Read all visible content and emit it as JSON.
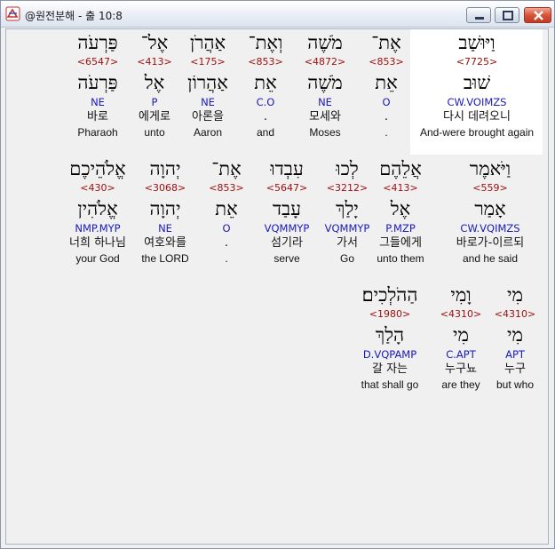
{
  "window": {
    "title": "@원전분해 - 출 10:8",
    "buttons": {
      "minimize": "minimize",
      "maximize": "maximize",
      "close": "close"
    }
  },
  "verse": {
    "rows": [
      {
        "words": [
          {
            "heb": "וַיּוּשַׁב",
            "strong": "<7725>",
            "lex": "שׁוּב",
            "parse": "CW.VOIMZS",
            "kor": "다시 데려오니",
            "eng": "And-were brought again"
          },
          {
            "heb": "אֶת־",
            "strong": "<853>",
            "lex": "אֵת",
            "parse": "O",
            "kor": ".",
            "eng": "."
          },
          {
            "heb": "מֹשֶׁה",
            "strong": "<4872>",
            "lex": "מֹשֶׁה",
            "parse": "NE",
            "kor": "모세와",
            "eng": "Moses"
          },
          {
            "heb": "וְאֶת־",
            "strong": "<853>",
            "lex": "אֵת",
            "parse": "C.O",
            "kor": ".",
            "eng": "and"
          },
          {
            "heb": "אַהֲרֹן",
            "strong": "<175>",
            "lex": "אַהֲרוֹן",
            "parse": "NE",
            "kor": "아론을",
            "eng": "Aaron"
          },
          {
            "heb": "אֶל־",
            "strong": "<413>",
            "lex": "אֶל",
            "parse": "P",
            "kor": "에게로",
            "eng": "unto"
          },
          {
            "heb": "פַּרְעֹה",
            "strong": "<6547>",
            "lex": "פַּרְעֹה",
            "parse": "NE",
            "kor": "바로",
            "eng": "Pharaoh"
          }
        ]
      },
      {
        "words": [
          {
            "heb": "וַיֹּאמֶר",
            "strong": "<559>",
            "lex": "אָמַר",
            "parse": "CW.VQIMZS",
            "kor": "바로가-이르되",
            "eng": "and he said"
          },
          {
            "heb": "אֲלֵהֶם",
            "strong": "<413>",
            "lex": "אֶל",
            "parse": "P.MZP",
            "kor": "그들에게",
            "eng": "unto them"
          },
          {
            "heb": "לְכוּ",
            "strong": "<3212>",
            "lex": "יָלַךְ",
            "parse": "VQMMYP",
            "kor": "가서",
            "eng": "Go"
          },
          {
            "heb": "עִבְדוּ",
            "strong": "<5647>",
            "lex": "עָבַד",
            "parse": "VQMMYP",
            "kor": "섬기라",
            "eng": "serve"
          },
          {
            "heb": "אֶת־",
            "strong": "<853>",
            "lex": "אֵת",
            "parse": "O",
            "kor": ".",
            "eng": "."
          },
          {
            "heb": "יְהוָה",
            "strong": "<3068>",
            "lex": "יְהוָה",
            "parse": "NE",
            "kor": "여호와를",
            "eng": "the LORD"
          },
          {
            "heb": "אֱלֹהֵיכֶם",
            "strong": "<430>",
            "lex": "אֱלֹהִין",
            "parse": "NMP.MYP",
            "kor": "너희 하나님",
            "eng": "your God"
          }
        ]
      },
      {
        "words": [
          {
            "heb": "מִי",
            "strong": "<4310>",
            "lex": "מִי",
            "parse": "APT",
            "kor": "누구",
            "eng": "but who"
          },
          {
            "heb": "וָמִי",
            "strong": "<4310>",
            "lex": "מִי",
            "parse": "C.APT",
            "kor": "누구뇨",
            "eng": "are they"
          },
          {
            "heb": "הַהֹלְכִים׃",
            "strong": "<1980>",
            "lex": "הָלַךְ",
            "parse": "D.VQPAMP",
            "kor": "갈 자는",
            "eng": "that shall go"
          }
        ]
      }
    ]
  }
}
